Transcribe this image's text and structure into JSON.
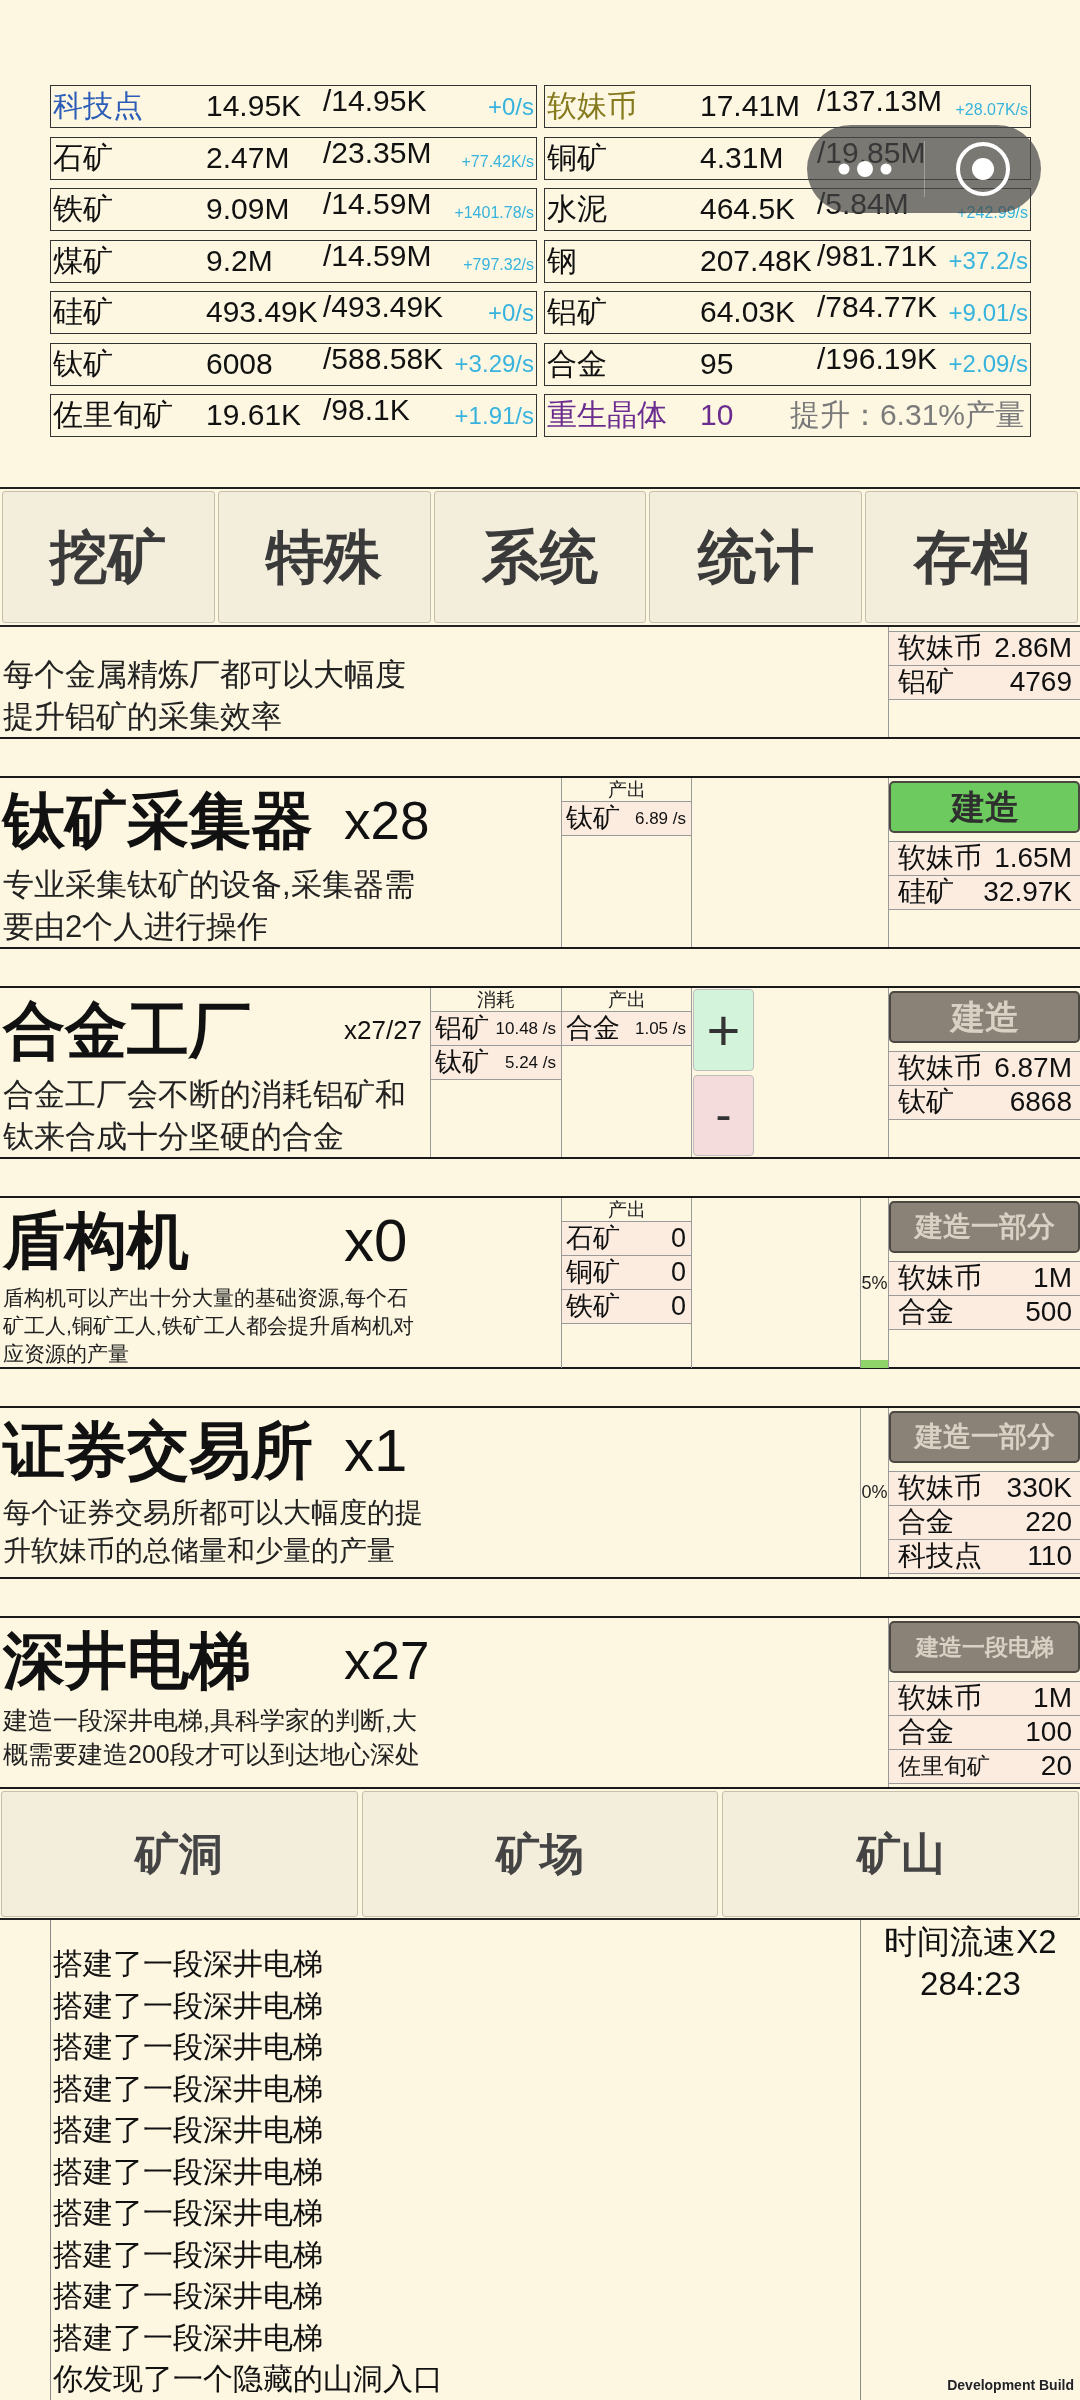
{
  "resources": [
    {
      "kind": "stock",
      "name": "科技点",
      "color": "#2a5cb8",
      "amount": "14.95K",
      "capacity": "/14.95K",
      "rate": "+0/s"
    },
    {
      "kind": "stock",
      "name": "软妹币",
      "color": "#857a1e",
      "amount": "17.41M",
      "capacity": "/137.13M",
      "rate": "+28.07K/s"
    },
    {
      "kind": "stock",
      "name": "石矿",
      "color": "#111111",
      "amount": "2.47M",
      "capacity": "/23.35M",
      "rate": "+77.42K/s"
    },
    {
      "kind": "stock",
      "name": "铜矿",
      "color": "#111111",
      "amount": "4.31M",
      "capacity": "/19.85M"
    },
    {
      "kind": "stock",
      "name": "铁矿",
      "color": "#111111",
      "amount": "9.09M",
      "capacity": "/14.59M",
      "rate": "+1401.78/s"
    },
    {
      "kind": "stock",
      "name": "水泥",
      "color": "#111111",
      "amount": "464.5K",
      "capacity": "/5.84M",
      "rate": "+242.99/s"
    },
    {
      "kind": "stock",
      "name": "煤矿",
      "color": "#111111",
      "amount": "9.2M",
      "capacity": "/14.59M",
      "rate": "+797.32/s"
    },
    {
      "kind": "stock",
      "name": "钢",
      "color": "#111111",
      "amount": "207.48K",
      "capacity": "/981.71K",
      "rate": "+37.2/s"
    },
    {
      "kind": "stock",
      "name": "硅矿",
      "color": "#111111",
      "amount": "493.49K",
      "capacity": "/493.49K",
      "rate": "+0/s"
    },
    {
      "kind": "stock",
      "name": "铝矿",
      "color": "#111111",
      "amount": "64.03K",
      "capacity": "/784.77K",
      "rate": "+9.01/s"
    },
    {
      "kind": "stock",
      "name": "钛矿",
      "color": "#111111",
      "amount": "6008",
      "capacity": "/588.58K",
      "rate": "+3.29/s"
    },
    {
      "kind": "stock",
      "name": "合金",
      "color": "#111111",
      "amount": "95",
      "capacity": "/196.19K",
      "rate": "+2.09/s"
    },
    {
      "kind": "stock",
      "name": "佐里旬矿",
      "color": "#111111",
      "amount": "19.61K",
      "capacity": "/98.1K",
      "rate": "+1.91/s"
    },
    {
      "kind": "bonus",
      "name": "重生晶体",
      "color": "#6a2c8e",
      "amount": "10",
      "note": "提升：6.31%产量"
    }
  ],
  "tabs": [
    "挖矿",
    "特殊",
    "系统",
    "统计",
    "存档"
  ],
  "buildings": [
    {
      "description": "每个金属精炼厂都可以大幅度提升铝矿的采集效率",
      "costs": [
        {
          "name": "软妹币",
          "amount": "2.86M"
        },
        {
          "name": "铝矿",
          "amount": "4769"
        }
      ]
    },
    {
      "title": "钛矿采集器",
      "count": "x28",
      "description": "专业采集钛矿的设备,采集器需要由2个人进行操作",
      "output": {
        "header": "产出",
        "items": [
          {
            "name": "钛矿",
            "value": "6.89 /s"
          }
        ]
      },
      "build_button": {
        "label": "建造",
        "enabled": true
      },
      "costs": [
        {
          "name": "软妹币",
          "amount": "1.65M"
        },
        {
          "name": "硅矿",
          "amount": "32.97K"
        }
      ]
    },
    {
      "title": "合金工厂",
      "count": "x27/27",
      "description": "合金工厂会不断的消耗铝矿和钛来合成十分坚硬的合金",
      "input": {
        "header": "消耗",
        "items": [
          {
            "name": "铝矿",
            "value": "10.48 /s"
          },
          {
            "name": "钛矿",
            "value": "5.24 /s"
          }
        ]
      },
      "output": {
        "header": "产出",
        "items": [
          {
            "name": "合金",
            "value": "1.05 /s"
          }
        ]
      },
      "adjust_buttons": [
        {
          "kind": "increase",
          "label": "+"
        },
        {
          "kind": "decrease",
          "label": "-"
        }
      ],
      "build_button": {
        "label": "建造",
        "enabled": false
      },
      "costs": [
        {
          "name": "软妹币",
          "amount": "6.87M"
        },
        {
          "name": "钛矿",
          "amount": "6868"
        }
      ]
    },
    {
      "title": "盾构机",
      "count": "x0",
      "description": "盾构机可以产出十分大量的基础资源,每个石矿工人,铜矿工人,铁矿工人都会提升盾构机对应资源的产量",
      "output": {
        "header": "产出",
        "items": [
          {
            "name": "石矿",
            "value": "0"
          },
          {
            "name": "铜矿",
            "value": "0"
          },
          {
            "name": "铁矿",
            "value": "0"
          }
        ]
      },
      "progress": {
        "label": "5%",
        "level": 0.05
      },
      "build_button": {
        "label": "建造一部分",
        "enabled": false
      },
      "costs": [
        {
          "name": "软妹币",
          "amount": "1M"
        },
        {
          "name": "合金",
          "amount": "500"
        }
      ]
    },
    {
      "title": "证券交易所",
      "count": "x1",
      "description": "每个证券交易所都可以大幅度的提升软妹币的总储量和少量的产量",
      "progress": {
        "label": "0%",
        "level": 0
      },
      "build_button": {
        "label": "建造一部分",
        "enabled": false
      },
      "costs": [
        {
          "name": "软妹币",
          "amount": "330K"
        },
        {
          "name": "合金",
          "amount": "220"
        },
        {
          "name": "科技点",
          "amount": "110"
        }
      ]
    },
    {
      "title": "深井电梯",
      "count": "x27",
      "description": "建造一段深井电梯,具科学家的判断,大概需要建造200段才可以到达地心深处",
      "build_button": {
        "label": "建造一段电梯",
        "enabled": false
      },
      "costs": [
        {
          "name": "软妹币",
          "amount": "1M"
        },
        {
          "name": "合金",
          "amount": "100"
        },
        {
          "name": "佐里旬矿",
          "amount": "20"
        }
      ]
    }
  ],
  "sections": [
    "矿洞",
    "矿场",
    "矿山"
  ],
  "log": [
    "搭建了一段深井电梯",
    "搭建了一段深井电梯",
    "搭建了一段深井电梯",
    "搭建了一段深井电梯",
    "搭建了一段深井电梯",
    "搭建了一段深井电梯",
    "搭建了一段深井电梯",
    "搭建了一段深井电梯",
    "搭建了一段深井电梯",
    "搭建了一段深井电梯",
    "你发现了一个隐藏的山洞入口"
  ],
  "time_speed": "时间流速X2",
  "timer": "284:23",
  "engine_label": "Development Build"
}
